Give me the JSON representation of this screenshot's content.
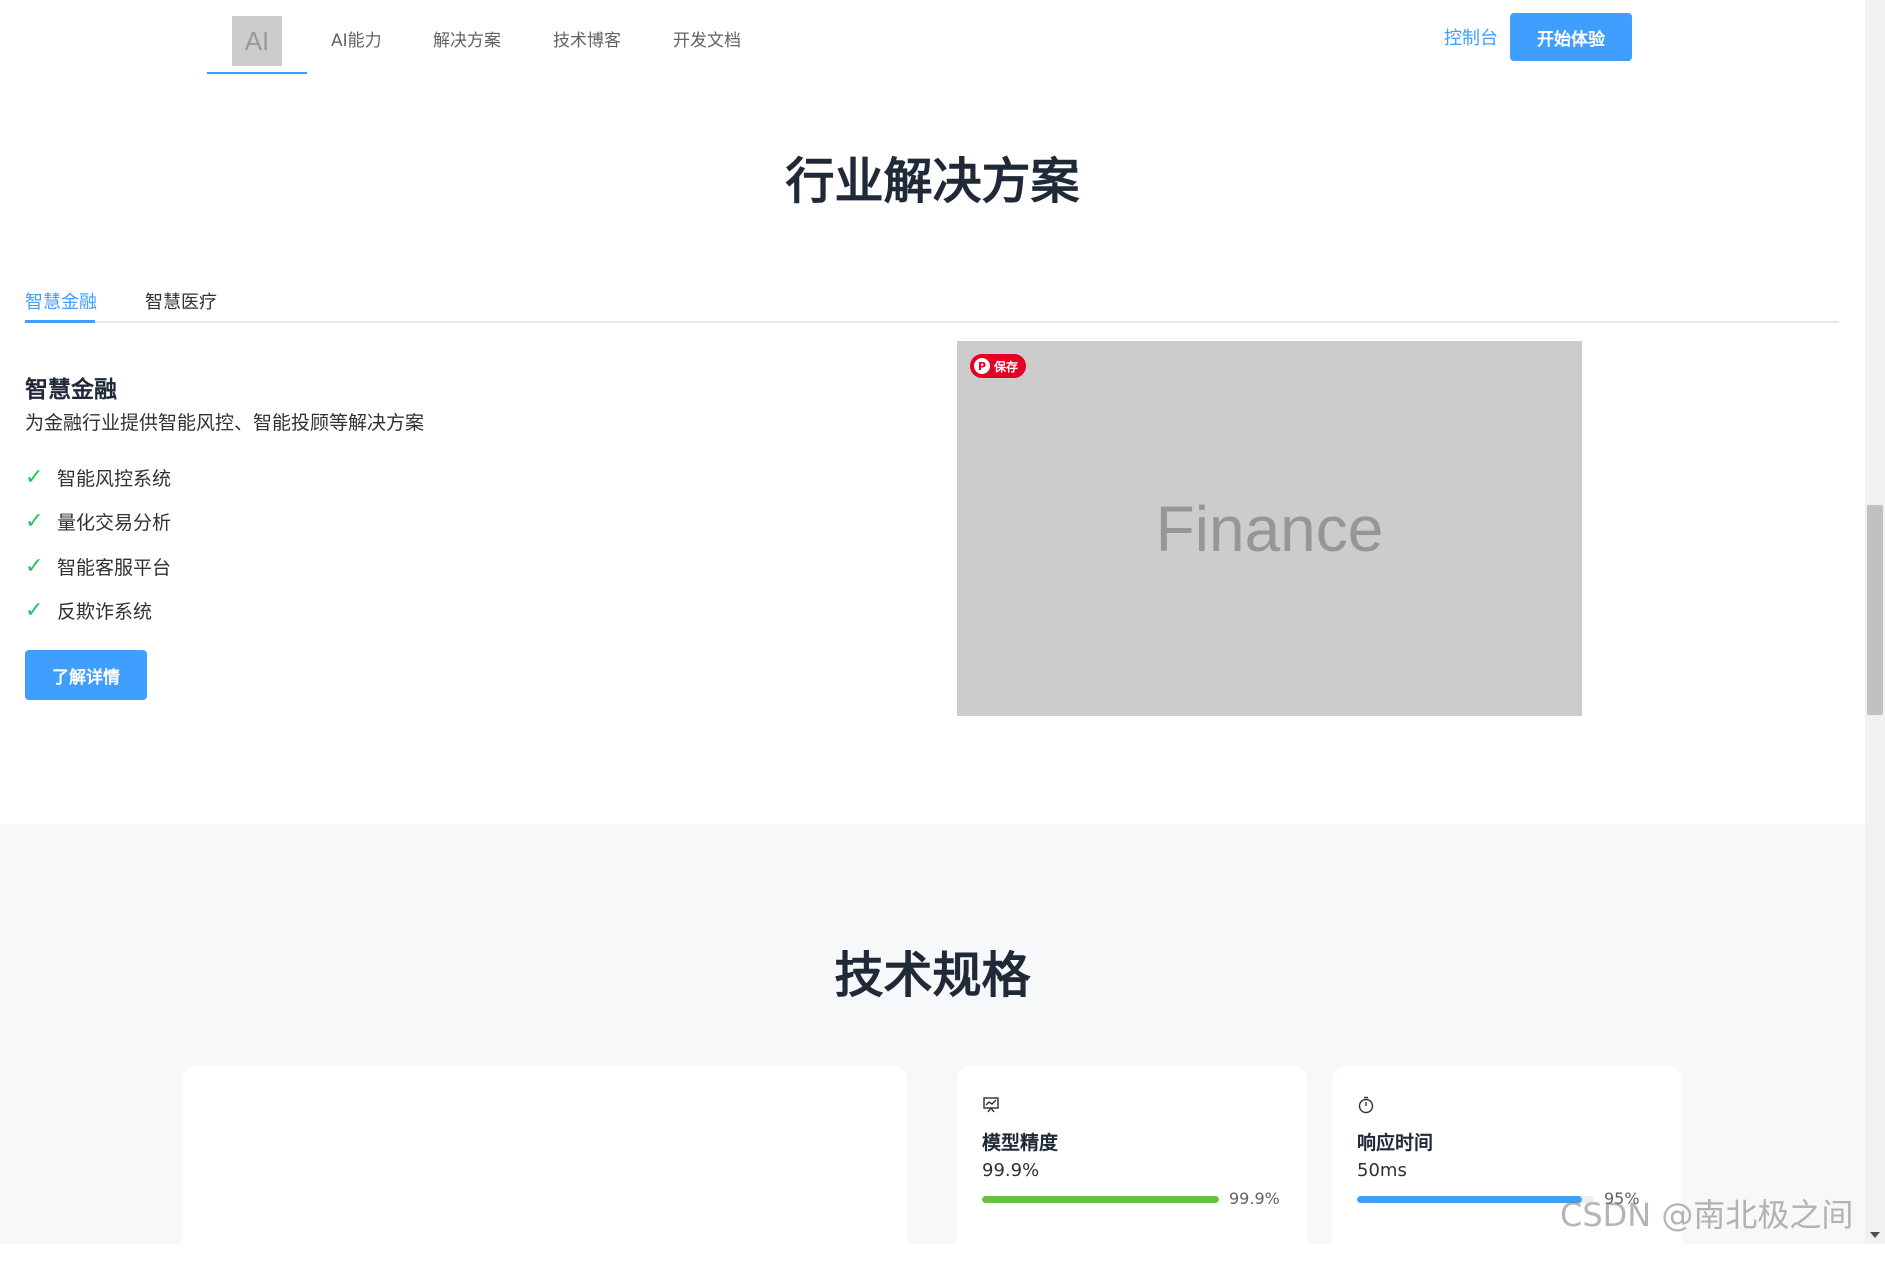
{
  "header": {
    "logo_text": "AI",
    "nav": [
      {
        "label": "AI能力"
      },
      {
        "label": "解决方案"
      },
      {
        "label": "技术博客"
      },
      {
        "label": "开发文档"
      }
    ],
    "console_label": "控制台",
    "start_label": "开始体验",
    "accent_color": "#409eff"
  },
  "solutions": {
    "title": "行业解决方案",
    "tabs": [
      {
        "label": "智慧金融",
        "active": true
      },
      {
        "label": "智慧医疗",
        "active": false
      }
    ],
    "active": {
      "heading": "智慧金融",
      "description": "为金融行业提供智能风控、智能投顾等解决方案",
      "features": [
        {
          "check": "✓",
          "text": "智能风控系统"
        },
        {
          "check": "✓",
          "text": "量化交易分析"
        },
        {
          "check": "✓",
          "text": "智能客服平台"
        },
        {
          "check": "✓",
          "text": "反欺诈系统"
        }
      ],
      "detail_label": "了解详情",
      "image_text": "Finance",
      "save_label": "保存"
    }
  },
  "specs": {
    "title": "技术规格",
    "cards": [
      {
        "icon": "chart-icon",
        "label": "模型精度",
        "value": "99.9%",
        "progress": 99.9,
        "progress_text": "99.9%",
        "color": "#67c23a"
      },
      {
        "icon": "stopwatch-icon",
        "label": "响应时间",
        "value": "50ms",
        "progress": 95,
        "progress_text": "95%",
        "color": "#409eff"
      }
    ]
  },
  "watermark": "CSDN @南北极之间"
}
